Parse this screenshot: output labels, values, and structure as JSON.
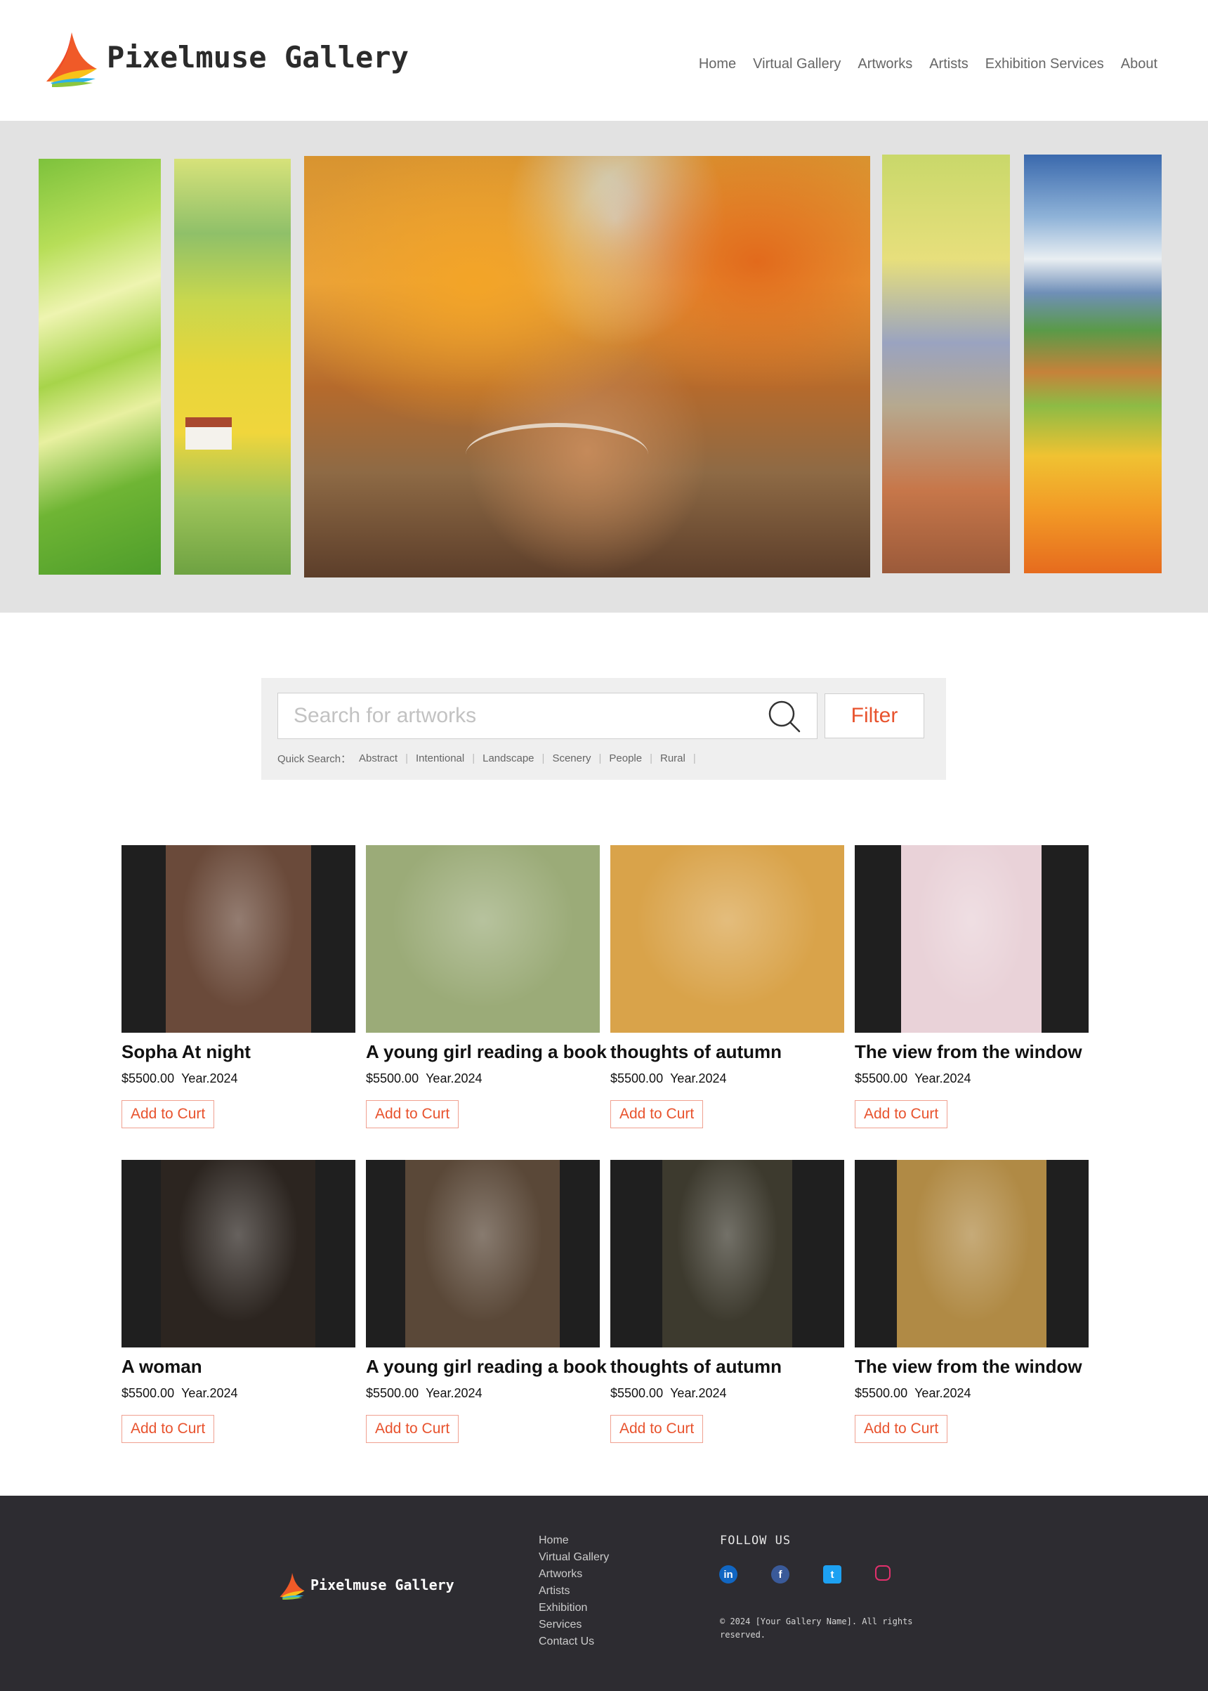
{
  "brand": {
    "name": "Pixelmuse Gallery"
  },
  "nav": {
    "items": [
      "Home",
      "Virtual Gallery",
      "Artworks",
      "Artists",
      "Exhibition Services",
      "About"
    ]
  },
  "hero": {
    "panels": [
      "green-swallows-painting",
      "yellow-field-house-painting",
      "autumn-bridge-painting",
      "birch-trees-painting",
      "countryside-flowers-painting"
    ]
  },
  "search": {
    "placeholder": "Search for artworks",
    "filter_label": "Filter",
    "quick_label": "Quick Search：",
    "tags": [
      "Abstract",
      "Intentional",
      "Landscape",
      "Scenery",
      "People",
      "Rural"
    ]
  },
  "artworks": [
    {
      "title": "Sopha At night",
      "price": "$5500.00",
      "year": "Year.2024",
      "button": "Add to Curt",
      "art_color": "#6a4a3a"
    },
    {
      "title": "A young girl reading a book",
      "price": "$5500.00",
      "year": "Year.2024",
      "button": "Add to Curt",
      "art_color": "#9bab78"
    },
    {
      "title": "thoughts of autumn",
      "price": "$5500.00",
      "year": "Year.2024",
      "button": "Add to Curt",
      "art_color": "#d9a34a"
    },
    {
      "title": "The view from the window",
      "price": "$5500.00",
      "year": "Year.2024",
      "button": "Add to Curt",
      "art_color": "#e9d2d8"
    },
    {
      "title": "A woman",
      "price": "$5500.00",
      "year": "Year.2024",
      "button": "Add to Curt",
      "art_color": "#2c2520"
    },
    {
      "title": "A young girl reading a book",
      "price": "$5500.00",
      "year": "Year.2024",
      "button": "Add to Curt",
      "art_color": "#5a4838"
    },
    {
      "title": "thoughts of autumn",
      "price": "$5500.00",
      "year": "Year.2024",
      "button": "Add to Curt",
      "art_color": "#3d3a2e"
    },
    {
      "title": "The view from the window",
      "price": "$5500.00",
      "year": "Year.2024",
      "button": "Add to Curt",
      "art_color": "#b08a45"
    }
  ],
  "footer": {
    "brand": "Pixelmuse Gallery",
    "links": [
      "Home",
      "Virtual Gallery",
      "Artworks",
      "Artists",
      "Exhibition",
      "Services",
      "Contact Us"
    ],
    "follow_label": "FOLLOW US",
    "socials": [
      {
        "icon": "linkedin-icon",
        "glyph": "in"
      },
      {
        "icon": "facebook-icon",
        "glyph": "f"
      },
      {
        "icon": "twitter-icon",
        "glyph": "t"
      },
      {
        "icon": "instagram-icon",
        "glyph": ""
      }
    ],
    "copyright": "© 2024 [Your Gallery Name]. All rights reserved."
  },
  "colors": {
    "accent": "#e8532e",
    "footer_bg": "#2d2c31",
    "hero_bg": "#e2e2e2"
  }
}
